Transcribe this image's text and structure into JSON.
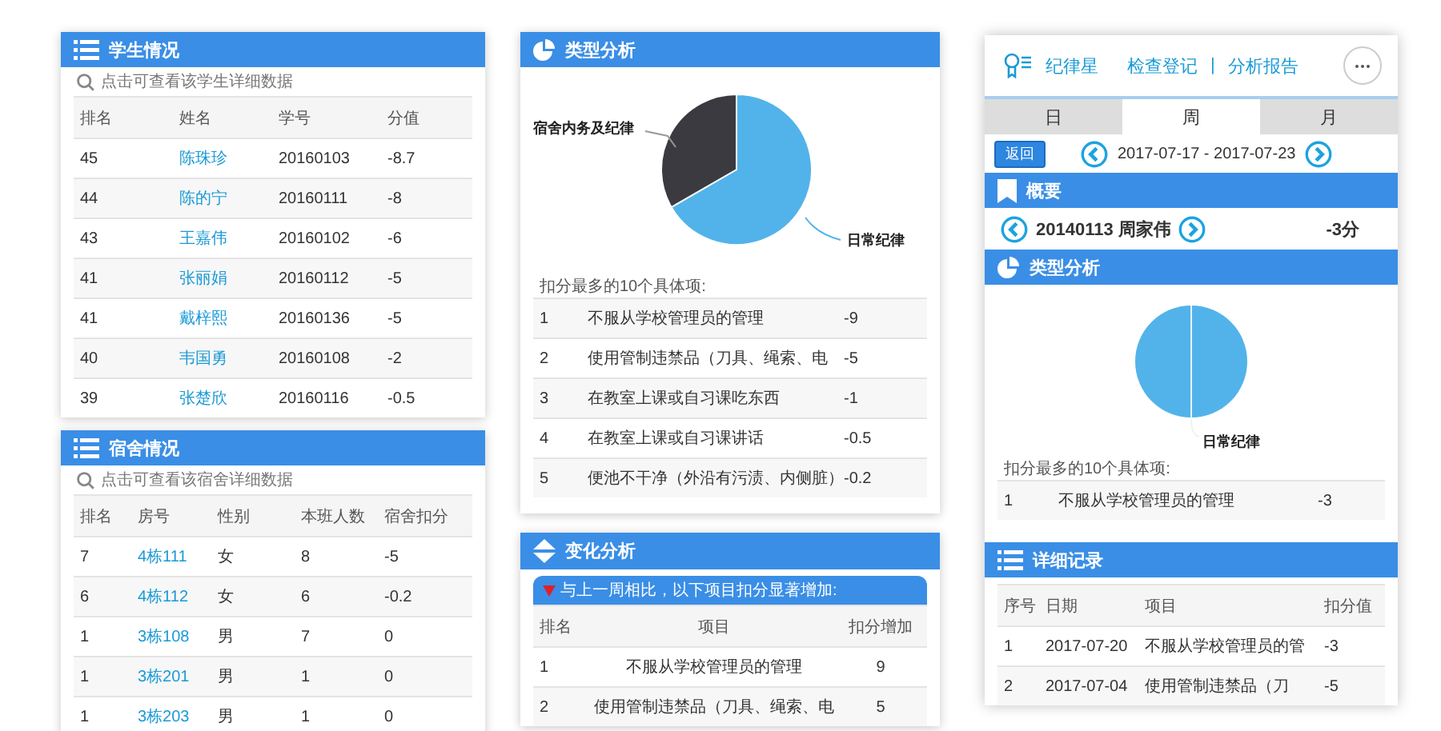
{
  "students": {
    "title": "学生情况",
    "hint": "点击可查看该学生详细数据",
    "columns": [
      "排名",
      "姓名",
      "学号",
      "分值"
    ],
    "rows": [
      [
        "45",
        "陈珠珍",
        "20160103",
        "-8.7"
      ],
      [
        "44",
        "陈的宁",
        "20160111",
        "-8"
      ],
      [
        "43",
        "王嘉伟",
        "20160102",
        "-6"
      ],
      [
        "41",
        "张丽娟",
        "20160112",
        "-5"
      ],
      [
        "41",
        "戴梓熙",
        "20160136",
        "-5"
      ],
      [
        "40",
        "韦国勇",
        "20160108",
        "-2"
      ],
      [
        "39",
        "张楚欣",
        "20160116",
        "-0.5"
      ]
    ]
  },
  "dorms": {
    "title": "宿舍情况",
    "hint": "点击可查看该宿舍详细数据",
    "columns": [
      "排名",
      "房号",
      "性别",
      "本班人数",
      "宿舍扣分"
    ],
    "rows": [
      [
        "7",
        "4栋111",
        "女",
        "8",
        "-5"
      ],
      [
        "6",
        "4栋112",
        "女",
        "6",
        "-0.2"
      ],
      [
        "1",
        "3栋108",
        "男",
        "7",
        "0"
      ],
      [
        "1",
        "3栋201",
        "男",
        "1",
        "0"
      ],
      [
        "1",
        "3栋203",
        "男",
        "1",
        "0"
      ]
    ]
  },
  "type_analysis": {
    "title": "类型分析",
    "pie_labels": [
      "宿舍内务及纪律",
      "日常纪律"
    ],
    "caption": "扣分最多的10个具体项:",
    "rows": [
      [
        "1",
        "不服从学校管理员的管理",
        "-9"
      ],
      [
        "2",
        "使用管制违禁品（刀具、绳索、电",
        "-5"
      ],
      [
        "3",
        "在教室上课或自习课吃东西",
        "-1"
      ],
      [
        "4",
        "在教室上课或自习课讲话",
        "-0.5"
      ],
      [
        "5",
        "便池不干净（外沿有污渍、内侧脏）",
        "-0.2"
      ]
    ]
  },
  "change_analysis": {
    "title": "变化分析",
    "notice": "与上一周相比，以下项目扣分显著增加:",
    "columns": [
      "排名",
      "项目",
      "扣分增加"
    ],
    "rows": [
      [
        "1",
        "不服从学校管理员的管理",
        "9"
      ],
      [
        "2",
        "使用管制违禁品（刀具、绳索、电",
        "5"
      ]
    ]
  },
  "report": {
    "app_name": "纪律星",
    "nav_links": [
      "检查登记",
      "分析报告"
    ],
    "separator": "|",
    "tabs": [
      {
        "label": "日",
        "selected": false
      },
      {
        "label": "周",
        "selected": true
      },
      {
        "label": "月",
        "selected": false
      }
    ],
    "back_button": "返回",
    "date_range": "2017-07-17 - 2017-07-23",
    "summary": {
      "title": "概要",
      "person": "20140113 周家伟",
      "score": "-3分"
    },
    "type_analysis": {
      "title": "类型分析",
      "pie_labels": [
        "日常纪律"
      ],
      "caption": "扣分最多的10个具体项:",
      "rows": [
        [
          "1",
          "不服从学校管理员的管理",
          "-3"
        ]
      ]
    },
    "details": {
      "title": "详细记录",
      "columns": [
        "序号",
        "日期",
        "项目",
        "扣分值"
      ],
      "rows": [
        [
          "1",
          "2017-07-20",
          "不服从学校管理员的管",
          "-3"
        ],
        [
          "2",
          "2017-07-04",
          "使用管制违禁品（刀",
          "-5"
        ]
      ]
    }
  }
}
